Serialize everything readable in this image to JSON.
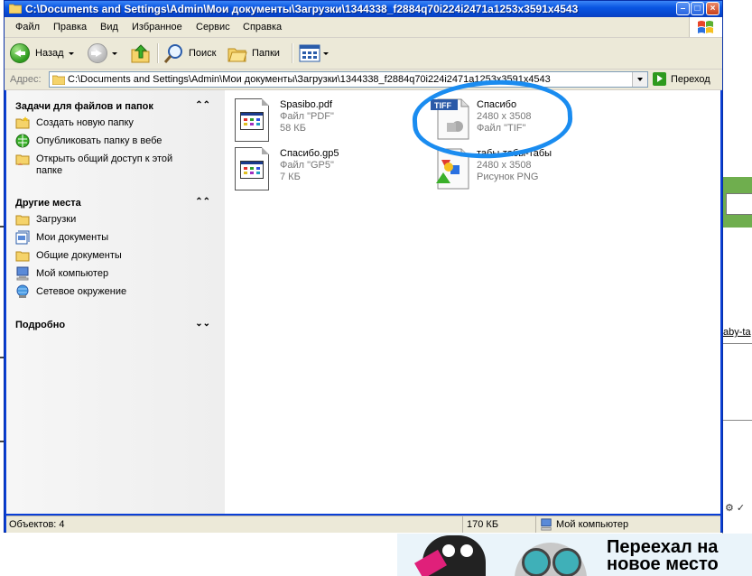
{
  "window": {
    "title": "C:\\Documents and Settings\\Admin\\Мои документы\\Загрузки\\1344338_f2884q70i224i2471a1253x3591x4543"
  },
  "menu": [
    "Файл",
    "Правка",
    "Вид",
    "Избранное",
    "Сервис",
    "Справка"
  ],
  "toolbar": {
    "back_label": "Назад",
    "search_label": "Поиск",
    "folders_label": "Папки"
  },
  "address": {
    "label": "Адрес:",
    "path": "C:\\Documents and Settings\\Admin\\Мои документы\\Загрузки\\1344338_f2884q70i224i2471a1253x3591x4543",
    "go_label": "Переход"
  },
  "taskpane": {
    "tasks_title": "Задачи для файлов и папок",
    "tasks": [
      {
        "label": "Создать новую папку"
      },
      {
        "label": "Опубликовать папку в вебе"
      },
      {
        "label": "Открыть общий доступ к этой папке"
      }
    ],
    "places_title": "Другие места",
    "places": [
      {
        "label": "Загрузки"
      },
      {
        "label": "Мои документы"
      },
      {
        "label": "Общие документы"
      },
      {
        "label": "Мой компьютер"
      },
      {
        "label": "Сетевое окружение"
      }
    ],
    "details_title": "Подробно"
  },
  "files": [
    {
      "name": "Spasibo.pdf",
      "line2": "Файл \"PDF\"",
      "line3": "58 КБ"
    },
    {
      "name": "Спасибо.gp5",
      "line2": "Файл \"GP5\"",
      "line3": "7 КБ"
    },
    {
      "name": "Спасибо",
      "line2": "2480 x 3508",
      "line3": "Файл \"TIF\"",
      "badge": "TIFF"
    },
    {
      "name": "табы-табы-табы",
      "line2": "2480 x 3508",
      "line3": "Рисунок PNG"
    }
  ],
  "status": {
    "objects": "Объектов: 4",
    "size": "170 КБ",
    "location": "Мой компьютер"
  },
  "background": {
    "link_text": "aby-ta",
    "banner_text_1": "Переехал на",
    "banner_text_2": "новое место"
  },
  "colors": {
    "highlight": "#1a8cf0",
    "xp_blue": "#0a56e2",
    "chrome": "#ece9d8"
  }
}
